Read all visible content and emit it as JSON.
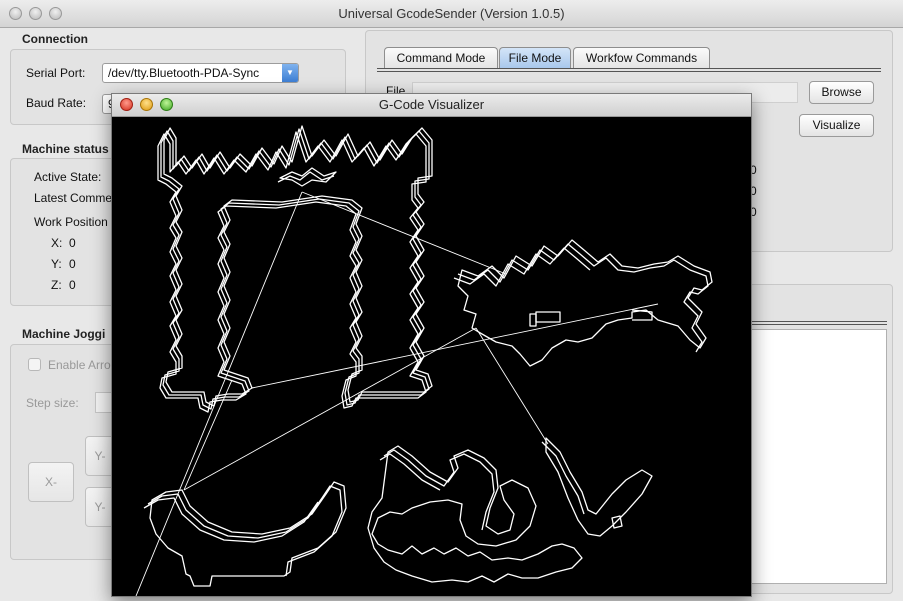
{
  "window": {
    "title": "Universal GcodeSender (Version 1.0.5)"
  },
  "connection": {
    "legend": "Connection",
    "serial_port_label": "Serial Port:",
    "serial_port_value": "/dev/tty.Bluetooth-PDA-Sync",
    "baud_rate_label": "Baud Rate:",
    "baud_rate_value": "9"
  },
  "machine_status": {
    "legend": "Machine status",
    "active_state_label": "Active State:",
    "latest_comment_label": "Latest Comme",
    "work_position_label": "Work Position",
    "x_label": "X:",
    "x_value": "0",
    "y_label": "Y:",
    "y_value": "0",
    "z_label": "Z:",
    "z_value": "0"
  },
  "jogging": {
    "legend": "Machine Joggi",
    "enable_arrow_label": "Enable Arro",
    "step_size_label": "Step size:",
    "x_minus": "X-",
    "y_plus": "Y-",
    "y_minus": "Y-"
  },
  "tabs": [
    {
      "label": "Command Mode",
      "active": false
    },
    {
      "label": "File Mode",
      "active": true
    },
    {
      "label": "Workfow Commands",
      "active": false
    }
  ],
  "file_mode": {
    "file_label": "File",
    "browse_button": "Browse",
    "visualize_button": "Visualize",
    "stat_values": [
      "0",
      "0",
      "0"
    ]
  },
  "visualizer": {
    "title": "G-Code Visualizer",
    "colors": {
      "background": "#000000",
      "toolpath": "#ffffff"
    }
  }
}
